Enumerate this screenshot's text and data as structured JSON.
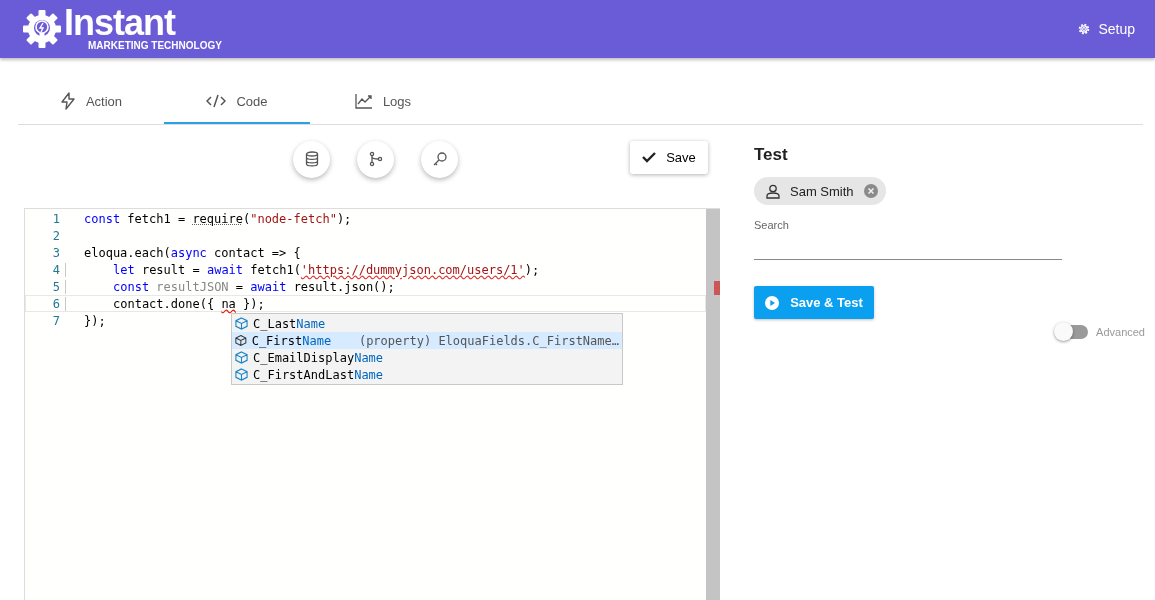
{
  "header": {
    "logo_title": "Instant",
    "logo_subtitle": "MARKETING TECHNOLOGY",
    "setup_label": "Setup"
  },
  "tabs": [
    {
      "label": "Action",
      "selected": false
    },
    {
      "label": "Code",
      "selected": true
    },
    {
      "label": "Logs",
      "selected": false
    }
  ],
  "toolbar": {
    "save_label": "Save"
  },
  "editor": {
    "lines": [
      {
        "number": "1",
        "current": false,
        "tokens": [
          {
            "kind": "keyword",
            "text": "const"
          },
          {
            "kind": "plain",
            "text": " fetch1 = "
          },
          {
            "kind": "warn",
            "text": "require"
          },
          {
            "kind": "plain",
            "text": "("
          },
          {
            "kind": "string",
            "text": "\"node-fetch\""
          },
          {
            "kind": "plain",
            "text": ");"
          }
        ]
      },
      {
        "number": "2",
        "current": false
      },
      {
        "number": "3",
        "current": false,
        "tokens": [
          {
            "kind": "plain",
            "text": "eloqua.each("
          },
          {
            "kind": "keyword",
            "text": "async"
          },
          {
            "kind": "plain",
            "text": " contact => {"
          }
        ]
      },
      {
        "number": "4",
        "current": false,
        "indented": true,
        "tokens": [
          {
            "kind": "keyword",
            "text": "let"
          },
          {
            "kind": "plain",
            "text": " result = "
          },
          {
            "kind": "keyword",
            "text": "await"
          },
          {
            "kind": "plain",
            "text": " fetch1("
          },
          {
            "kind": "string-error",
            "text": "'https://dummyjson.com/users/1'"
          },
          {
            "kind": "plain",
            "text": ");"
          }
        ]
      },
      {
        "number": "5",
        "current": false,
        "indented": true,
        "tokens": [
          {
            "kind": "keyword",
            "text": "const"
          },
          {
            "kind": "dim",
            "text": " resultJSON"
          },
          {
            "kind": "plain",
            "text": " = "
          },
          {
            "kind": "keyword",
            "text": "await"
          },
          {
            "kind": "plain",
            "text": " result.json();"
          }
        ]
      },
      {
        "number": "6",
        "current": true,
        "indented": true,
        "tokens": [
          {
            "kind": "plain",
            "text": "contact.done({ "
          },
          {
            "kind": "error",
            "text": "na"
          },
          {
            "kind": "plain",
            "text": " });"
          }
        ]
      },
      {
        "number": "7",
        "current": false,
        "tokens": [
          {
            "kind": "plain",
            "text": "});"
          }
        ]
      }
    ],
    "suggestions": [
      {
        "prefix": "C_Last",
        "match": "Name",
        "selected": false
      },
      {
        "prefix": "C_First",
        "match": "Name",
        "selected": true,
        "detail": "(property) EloquaFields.C_FirstName…"
      },
      {
        "prefix": "C_EmailDisplay",
        "match": "Name",
        "selected": false
      },
      {
        "prefix": "C_FirstAndLast",
        "match": "Name",
        "selected": false
      }
    ]
  },
  "test": {
    "title": "Test",
    "chip": "Sam Smith",
    "search_label": "Search",
    "run_label": "Save & Test",
    "advanced": {
      "label": "Advanced",
      "on": false
    }
  }
}
